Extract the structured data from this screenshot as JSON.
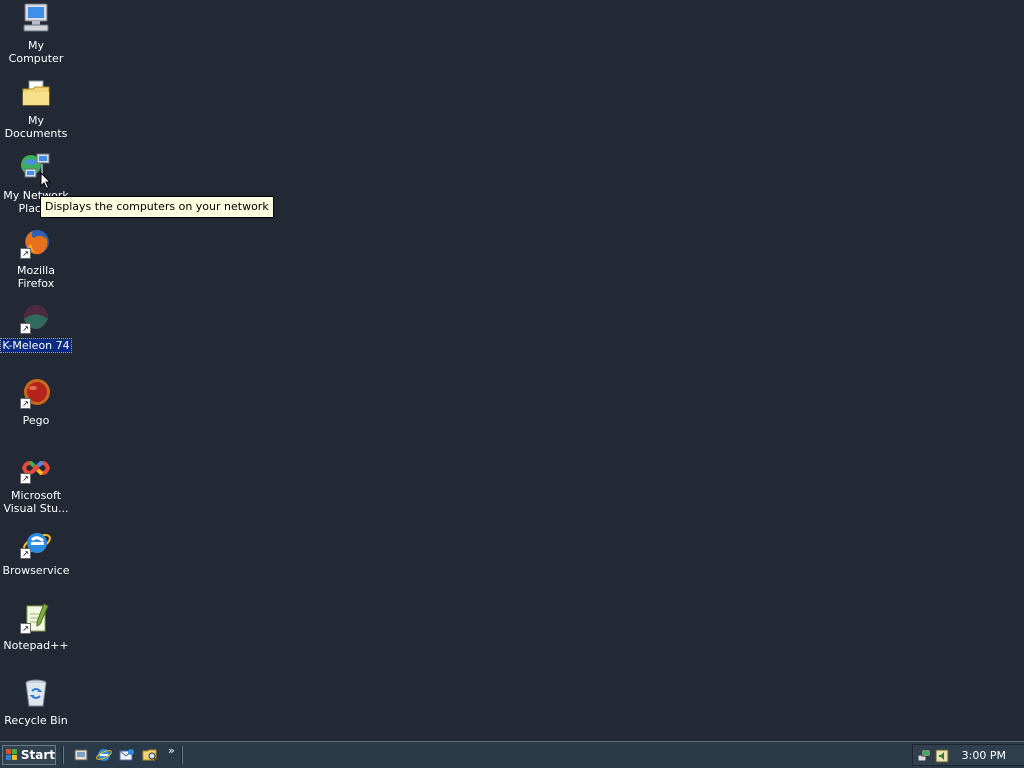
{
  "desktop": {
    "icons": [
      {
        "id": "my-computer",
        "label": "My Computer"
      },
      {
        "id": "my-documents",
        "label": "My Documents"
      },
      {
        "id": "my-network-places",
        "label": "My Network Places"
      },
      {
        "id": "mozilla-firefox",
        "label": "Mozilla Firefox"
      },
      {
        "id": "k-meleon",
        "label": "K-Meleon 74"
      },
      {
        "id": "pego",
        "label": "Pego"
      },
      {
        "id": "visual-studio",
        "label": "Microsoft Visual Stu..."
      },
      {
        "id": "browservice",
        "label": "Browservice"
      },
      {
        "id": "notepad-plus-plus",
        "label": "Notepad++"
      },
      {
        "id": "recycle-bin",
        "label": "Recycle Bin"
      }
    ],
    "selected_icon": "K-Meleon 74",
    "background_color": "#232934"
  },
  "tooltip": {
    "text": "Displays the computers on your network"
  },
  "taskbar": {
    "start_label": "Start",
    "quick_launch": [
      "show-desktop-icon",
      "internet-explorer-icon",
      "outlook-express-icon",
      "search-folder-icon"
    ],
    "chevron": "»",
    "clock": "3:00 PM"
  }
}
